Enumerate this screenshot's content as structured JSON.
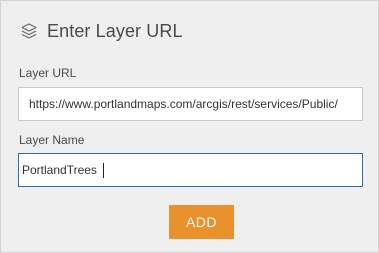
{
  "dialog": {
    "title": "Enter Layer URL",
    "title_icon": "layers-icon"
  },
  "layer_url": {
    "label": "Layer URL",
    "value": "https://www.portlandmaps.com/arcgis/rest/services/Public/"
  },
  "layer_name": {
    "label": "Layer Name",
    "value": "PortlandTrees"
  },
  "add_button": {
    "label": "ADD",
    "color": "#e8912d"
  },
  "colors": {
    "panel_bg": "#efefef",
    "focus_border": "#2d6da3",
    "text": "#4a4a4a"
  }
}
